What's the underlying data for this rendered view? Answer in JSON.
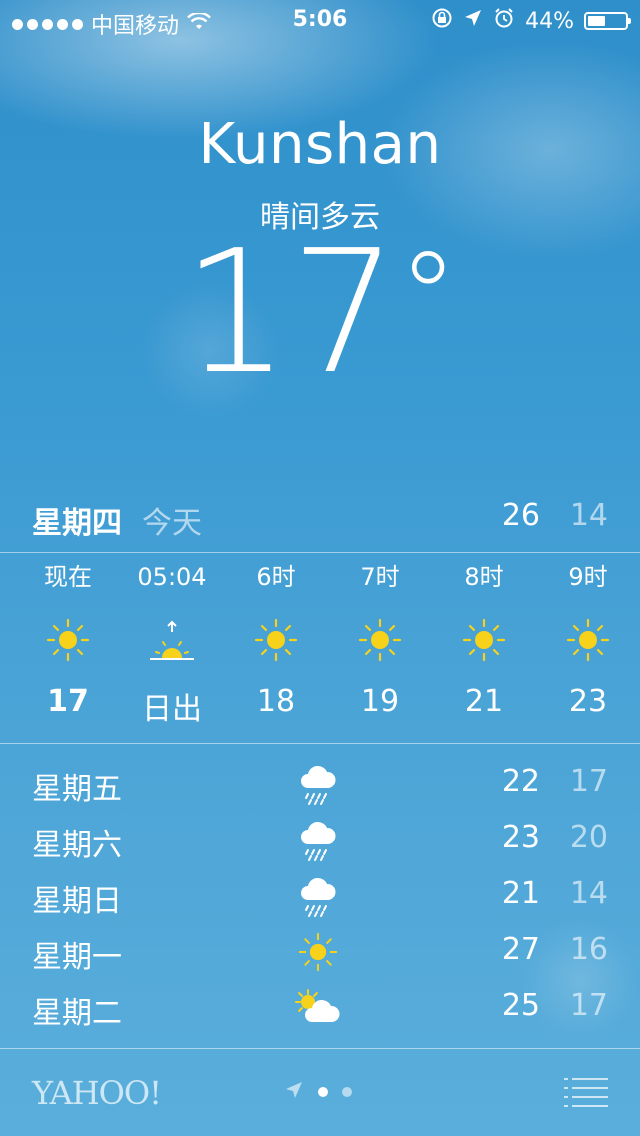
{
  "status_bar": {
    "carrier": "中国移动",
    "time": "5:06",
    "battery_percent": "44%",
    "battery_level": 0.44,
    "icons": [
      "wifi-icon",
      "rotation-lock-icon",
      "location-arrow-icon",
      "alarm-icon",
      "battery-icon"
    ]
  },
  "weather": {
    "city": "Kunshan",
    "condition": "晴间多云",
    "temperature": "17",
    "degree_symbol": "°"
  },
  "today": {
    "day": "星期四",
    "label": "今天",
    "high": "26",
    "low": "14"
  },
  "hourly": [
    {
      "time": "现在",
      "icon": "sun-icon",
      "temp": "17",
      "bold": true
    },
    {
      "time": "05:04",
      "icon": "sunrise-icon",
      "temp": "日出"
    },
    {
      "time": "6时",
      "icon": "sun-icon",
      "temp": "18"
    },
    {
      "time": "7时",
      "icon": "sun-icon",
      "temp": "19"
    },
    {
      "time": "8时",
      "icon": "sun-icon",
      "temp": "21"
    },
    {
      "time": "9时",
      "icon": "sun-icon",
      "temp": "23"
    }
  ],
  "daily": [
    {
      "day": "星期五",
      "icon": "rain-cloud-icon",
      "high": "22",
      "low": "17"
    },
    {
      "day": "星期六",
      "icon": "rain-cloud-icon",
      "high": "23",
      "low": "20"
    },
    {
      "day": "星期日",
      "icon": "rain-cloud-icon",
      "high": "21",
      "low": "14"
    },
    {
      "day": "星期一",
      "icon": "sun-icon",
      "high": "27",
      "low": "16"
    },
    {
      "day": "星期二",
      "icon": "partly-cloudy-icon",
      "high": "25",
      "low": "17"
    }
  ],
  "footer": {
    "brand": "YAHOO!",
    "page_count": 2,
    "active_page": 1
  },
  "colors": {
    "sun": "#f7d21a",
    "sky_top": "#2f8fca",
    "sky_bottom": "#5aaedb"
  }
}
